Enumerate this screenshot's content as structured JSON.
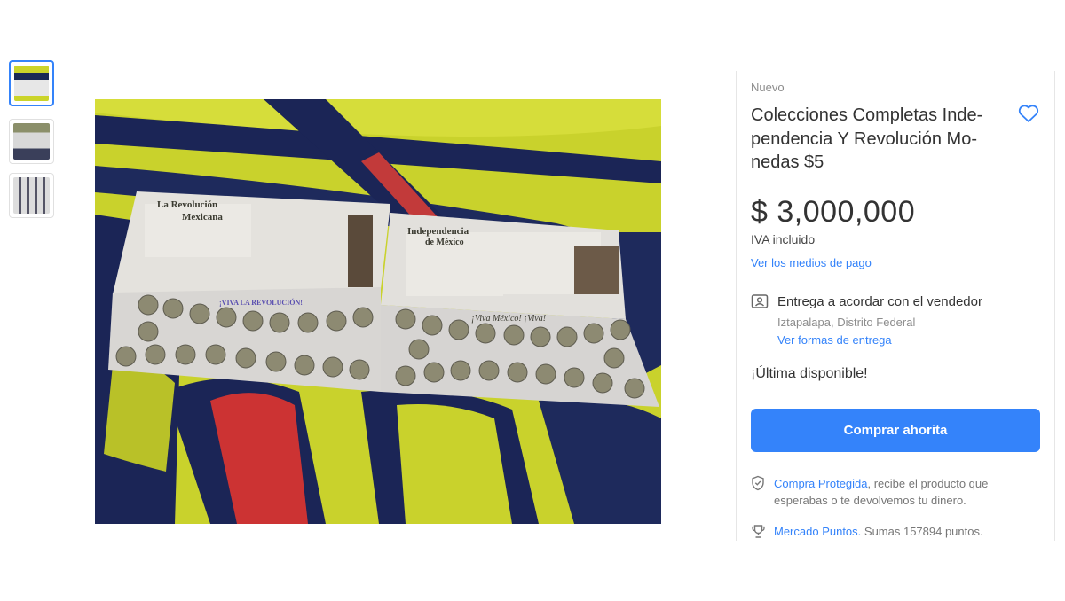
{
  "gallery": {
    "thumbnails": [
      {
        "icon": "thumbnail-1",
        "active": true
      },
      {
        "icon": "thumbnail-2",
        "active": false
      },
      {
        "icon": "thumbnail-3",
        "active": false
      }
    ],
    "main_photo": {
      "booklet_left_title_1": "La Revolución",
      "booklet_left_title_2": "Mexicana",
      "booklet_left_banner": "¡VIVA LA REVOLUCIÓN!",
      "booklet_right_title_1": "Independencia",
      "booklet_right_title_2": "de México",
      "booklet_right_banner": "¡Viva México! ¡Viva!"
    }
  },
  "product": {
    "condition": "Nuevo",
    "title": "Colecciones Completas Independencia Y Revolución Monedas $5",
    "title_lines": [
      "Colecciones Completas Inde-",
      "pendencia Y Revolución Mo-",
      "nedas $5"
    ],
    "favorite_icon": "heart-icon",
    "price": "$ 3,000,000",
    "tax_note": "IVA incluido",
    "payment_link": "Ver los medios de pago"
  },
  "shipping": {
    "icon": "handshake-icon",
    "title": "Entrega a acordar con el vendedor",
    "location": "Iztapalapa, Distrito Federal",
    "link": "Ver formas de entrega"
  },
  "stock": {
    "label": "¡Última disponible!"
  },
  "actions": {
    "buy_now": "Comprar ahorita"
  },
  "protection": {
    "icon": "shield-icon",
    "link": "Compra Protegida",
    "text": ", recibe el producto que esperabas o te devolvemos tu dinero."
  },
  "points": {
    "icon": "trophy-icon",
    "link": "Mercado Puntos.",
    "text": " Sumas 157894 puntos."
  },
  "colors": {
    "accent": "#3483fa",
    "text": "#333333",
    "muted": "#8c8c8c"
  }
}
